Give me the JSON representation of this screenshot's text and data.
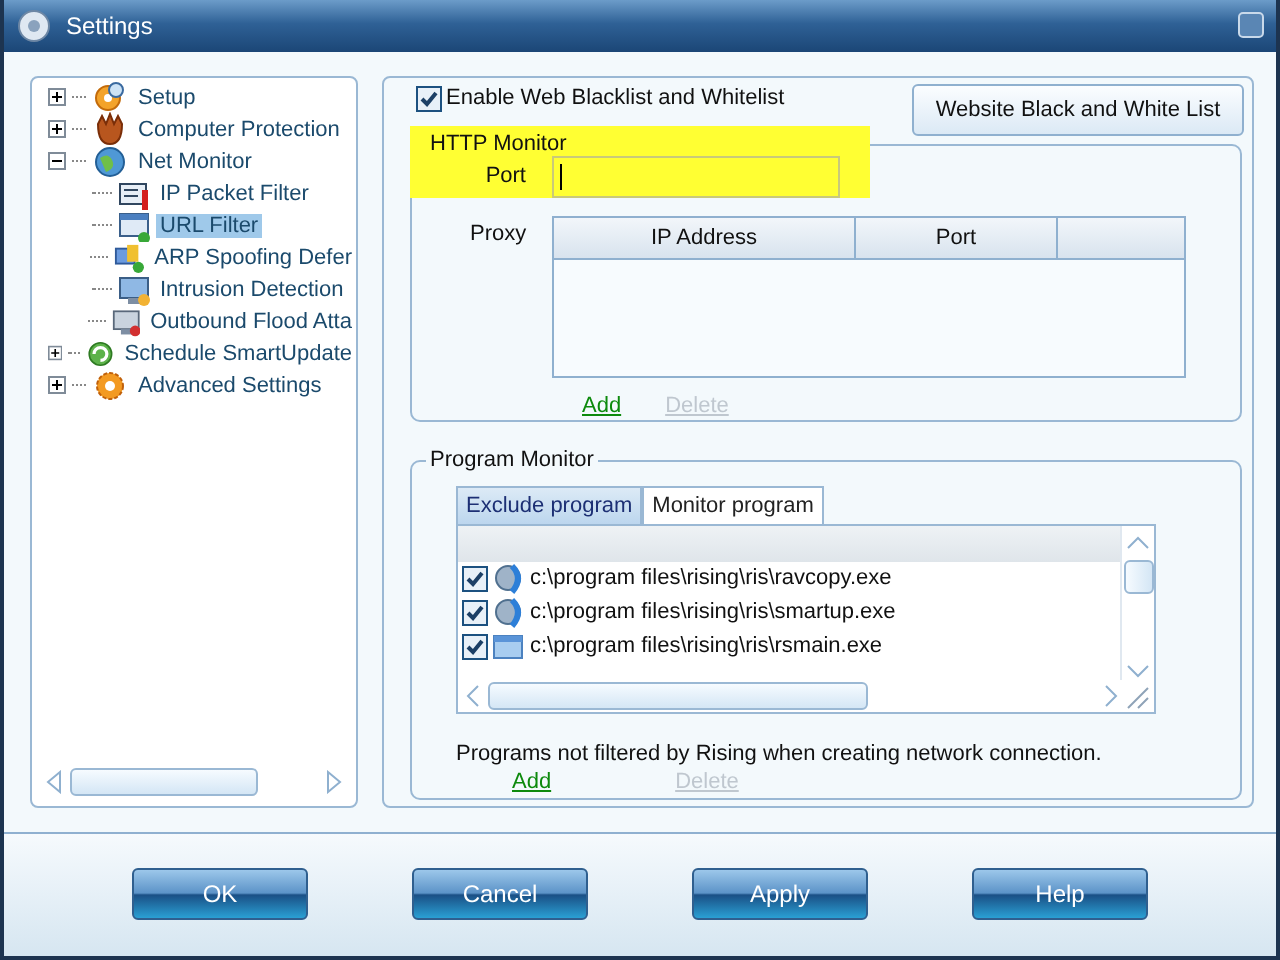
{
  "window": {
    "title": "Settings"
  },
  "tree": [
    {
      "label": "Setup",
      "expanded": false,
      "selected": false
    },
    {
      "label": "Computer Protection",
      "expanded": false,
      "selected": false
    },
    {
      "label": "Net Monitor",
      "expanded": true,
      "selected": false,
      "children": [
        {
          "label": "IP Packet Filter",
          "selected": false
        },
        {
          "label": "URL Filter",
          "selected": true
        },
        {
          "label": "ARP Spoofing Defer",
          "selected": false
        },
        {
          "label": "Intrusion Detection",
          "selected": false
        },
        {
          "label": "Outbound Flood Atta",
          "selected": false
        }
      ]
    },
    {
      "label": "Schedule SmartUpdate",
      "expanded": false,
      "selected": false
    },
    {
      "label": "Advanced Settings",
      "expanded": false,
      "selected": false
    }
  ],
  "web_filter": {
    "enable": {
      "label": "Enable Web Blacklist and Whitelist",
      "checked": true
    },
    "list_button": "Website Black and White List"
  },
  "http_monitor": {
    "title": "HTTP Monitor",
    "highlighted": true,
    "port_label": "Port",
    "proxy_label": "Proxy",
    "proxy_columns": [
      "IP Address",
      "Port"
    ],
    "add": {
      "label": "Add",
      "disabled": false
    },
    "delete": {
      "label": "Delete",
      "disabled": true
    }
  },
  "program_monitor": {
    "title": "Program Monitor",
    "tabs": [
      {
        "label": "Exclude program",
        "selected": true
      },
      {
        "label": "Monitor program",
        "selected": false
      }
    ],
    "programs": [
      {
        "path": "c:\\program files\\rising\\ris\\ravcopy.exe",
        "checked": true
      },
      {
        "path": "c:\\program files\\rising\\ris\\smartup.exe",
        "checked": true
      },
      {
        "path": "c:\\program files\\rising\\ris\\rsmain.exe",
        "checked": true
      }
    ],
    "note": "Programs not filtered by Rising when creating network connection.",
    "add": {
      "label": "Add",
      "disabled": false
    },
    "delete": {
      "label": "Delete",
      "disabled": true
    }
  },
  "buttons": [
    "OK",
    "Cancel",
    "Apply",
    "Help"
  ]
}
